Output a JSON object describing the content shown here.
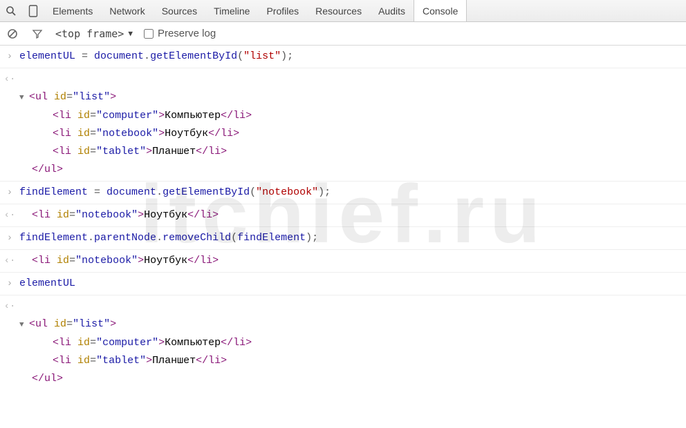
{
  "watermark": "itchief.ru",
  "tabs": {
    "elements": "Elements",
    "network": "Network",
    "sources": "Sources",
    "timeline": "Timeline",
    "profiles": "Profiles",
    "resources": "Resources",
    "audits": "Audits",
    "console": "Console"
  },
  "toolbar": {
    "context": "<top frame>",
    "preserve_label": "Preserve log"
  },
  "code": {
    "r1_var": "elementUL",
    "r1_eq": " = ",
    "r1_obj": "document",
    "r1_dot": ".",
    "r1_fn": "getElementById",
    "r1_p1": "(",
    "r1_arg": "\"list\"",
    "r1_p2": ");",
    "ul_open_lt": "<",
    "ul_open_tag": "ul",
    "ul_open_sp": " ",
    "ul_open_attr": "id",
    "ul_open_eq": "=",
    "ul_open_val": "\"list\"",
    "ul_open_gt": ">",
    "li1_lt": "<",
    "li1_tag": "li",
    "li1_sp": " ",
    "li1_attr": "id",
    "li1_eq": "=",
    "li1_val": "\"computer\"",
    "li1_gt": ">",
    "li1_txt": "Компьютер",
    "li1_clt": "</",
    "li1_ctag": "li",
    "li1_cgt": ">",
    "li2_lt": "<",
    "li2_tag": "li",
    "li2_sp": " ",
    "li2_attr": "id",
    "li2_eq": "=",
    "li2_val": "\"notebook\"",
    "li2_gt": ">",
    "li2_txt": "Ноутбук",
    "li2_clt": "</",
    "li2_ctag": "li",
    "li2_cgt": ">",
    "li3_lt": "<",
    "li3_tag": "li",
    "li3_sp": " ",
    "li3_attr": "id",
    "li3_eq": "=",
    "li3_val": "\"tablet\"",
    "li3_gt": ">",
    "li3_txt": "Планшет",
    "li3_clt": "</",
    "li3_ctag": "li",
    "li3_cgt": ">",
    "ul_close_lt": "</",
    "ul_close_tag": "ul",
    "ul_close_gt": ">",
    "r2_var": "findElement",
    "r2_eq": " = ",
    "r2_obj": "document",
    "r2_dot": ".",
    "r2_fn": "getElementById",
    "r2_p1": "(",
    "r2_arg": "\"notebook\"",
    "r2_p2": ");",
    "r3_obj": "findElement",
    "r3_d1": ".",
    "r3_pn": "parentNode",
    "r3_d2": ".",
    "r3_fn": "removeChild",
    "r3_p1": "(",
    "r3_arg": "findElement",
    "r3_p2": ");",
    "r4_var": "elementUL"
  }
}
